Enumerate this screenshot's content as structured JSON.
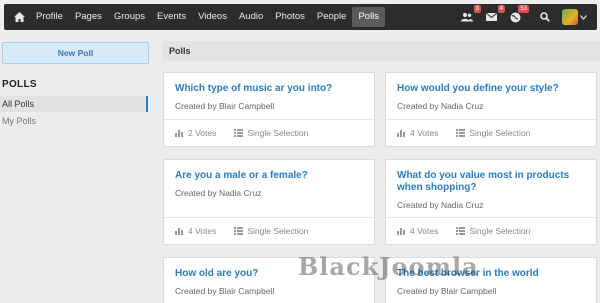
{
  "nav": {
    "home_icon": "home-icon",
    "items": [
      "Profile",
      "Pages",
      "Groups",
      "Events",
      "Videos",
      "Audio",
      "Photos",
      "People",
      "Polls"
    ],
    "active_index": 8,
    "badges": {
      "friends": "3",
      "messages": "4",
      "notifications": "53"
    },
    "icons": [
      "users-icon",
      "envelope-icon",
      "globe-icon",
      "search-icon",
      "chevron-down-icon"
    ]
  },
  "sidebar": {
    "new_poll_label": "New Poll",
    "heading": "POLLS",
    "items": [
      {
        "label": "All Polls",
        "active": true
      },
      {
        "label": "My Polls",
        "active": false
      }
    ]
  },
  "main": {
    "title": "Polls",
    "cards": [
      {
        "title": "Which type of music ar you into?",
        "author": "Created by Blair Campbell",
        "votes": "2 Votes",
        "type": "Single Selection"
      },
      {
        "title": "How would you define your style?",
        "author": "Created by Nadia Cruz",
        "votes": "4 Votes",
        "type": "Single Selection"
      },
      {
        "title": "Are you a male or a female?",
        "author": "Created by Nadia Cruz",
        "votes": "4 Votes",
        "type": "Single Selection"
      },
      {
        "title": "What do you value most in products when shopping?",
        "author": "Created by Nadia Cruz",
        "votes": "4 Votes",
        "type": "Single Selection"
      },
      {
        "title": "How old are you?",
        "author": "Created by Blair Campbell",
        "votes": "",
        "type": ""
      },
      {
        "title": "The best browser in the world",
        "author": "Created by Blair Campbell",
        "votes": "",
        "type": ""
      }
    ]
  },
  "watermark": "BlackJoomla",
  "colors": {
    "navbar": "#2c2c2c",
    "link": "#2a7dc2",
    "badge": "#d9534f"
  }
}
